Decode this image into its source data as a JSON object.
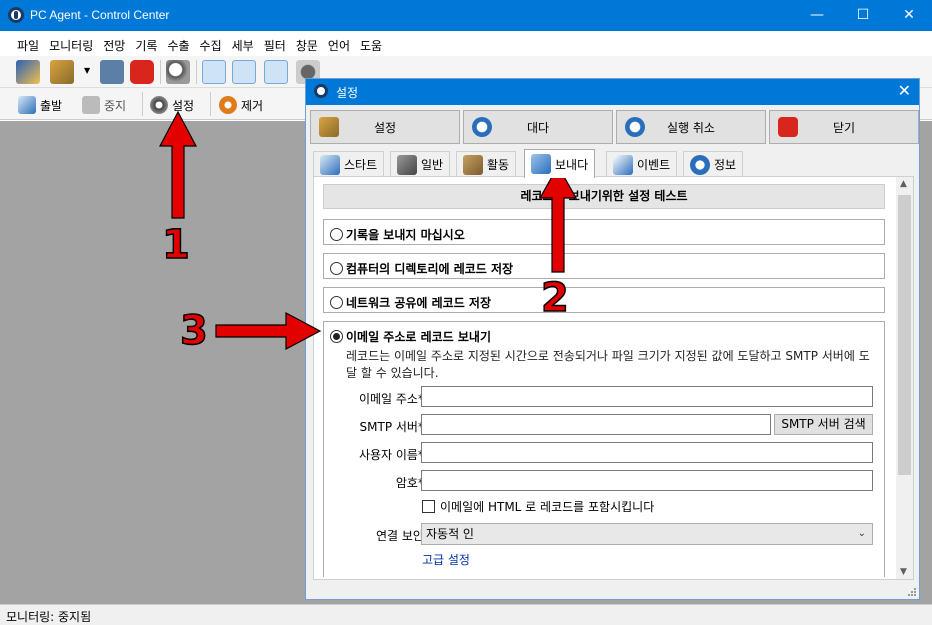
{
  "window": {
    "title": "PC Agent - Control Center",
    "min": "—",
    "max": "☐",
    "close": "✕"
  },
  "menu": [
    "파일",
    "모니터링",
    "전망",
    "기록",
    "수출",
    "수집",
    "세부",
    "필터",
    "창문",
    "언어",
    "도움"
  ],
  "toolbar2": {
    "start": "출발",
    "stop": "중지",
    "settings": "설정",
    "remove": "제거"
  },
  "status": "모니터링: 중지됨",
  "dialog": {
    "title": "설정",
    "close": "✕",
    "buttons": [
      "설정",
      "대다",
      "실행 취소",
      "닫기"
    ],
    "tabs": [
      "스타트",
      "일반",
      "활동",
      "보내다",
      "이벤트",
      "정보"
    ],
    "header": "레코드를 보내기위한 설정 테스트",
    "options": [
      "기록을 보내지 마십시오",
      "컴퓨터의 디렉토리에 레코드 저장",
      "네트워크 공유에 레코드 저장",
      "이메일 주소로 레코드 보내기"
    ],
    "email_desc": "레코드는 이메일 주소로 지정된 시간으로 전송되거나 파일 크기가 지정된 값에 도달하고 SMTP 서버에 도달 할 수 있습니다.",
    "fields": {
      "email_label": "이메일 주소*:",
      "email_value": "",
      "smtp_label": "SMTP 서버*:",
      "smtp_value": "",
      "smtp_search": "SMTP 서버 검색",
      "user_label": "사용자 이름*:",
      "user_value": "",
      "pass_label": "암호*:",
      "pass_value": "",
      "html_checkbox": "이메일에 HTML 로 레코드를 포함시킵니다",
      "security_label": "연결 보안:",
      "security_value": "자동적 인",
      "advanced": "고급 설정"
    }
  },
  "annotations": [
    "1",
    "2",
    "3"
  ],
  "colors": {
    "titlebar": "#0078d7",
    "arrow": "#e30000",
    "workspace": "#a3a3a3"
  }
}
